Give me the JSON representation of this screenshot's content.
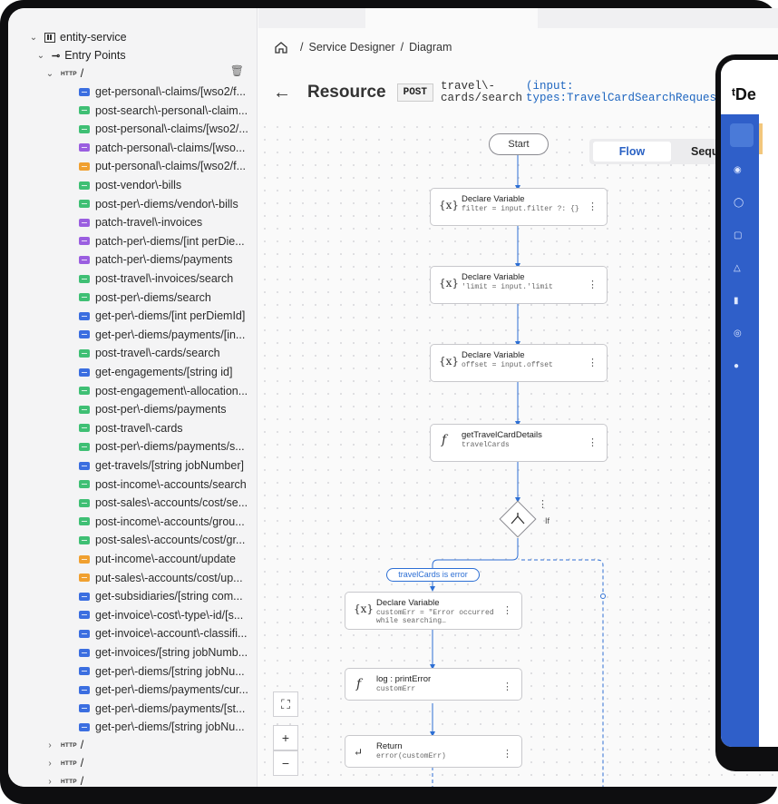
{
  "sidebar": {
    "service_name": "entity-service",
    "entry_points_label": "Entry Points",
    "http_label": "HTTP",
    "path_label": "/",
    "resources": [
      {
        "method": "get",
        "label": "get-personal\\-claims/[wso2/f..."
      },
      {
        "method": "post",
        "label": "post-search\\-personal\\-claim..."
      },
      {
        "method": "post",
        "label": "post-personal\\-claims/[wso2/..."
      },
      {
        "method": "patch",
        "label": "patch-personal\\-claims/[wso..."
      },
      {
        "method": "put",
        "label": "put-personal\\-claims/[wso2/f..."
      },
      {
        "method": "post",
        "label": "post-vendor\\-bills"
      },
      {
        "method": "post",
        "label": "post-per\\-diems/vendor\\-bills"
      },
      {
        "method": "patch",
        "label": "patch-travel\\-invoices"
      },
      {
        "method": "patch",
        "label": "patch-per\\-diems/[int perDie..."
      },
      {
        "method": "patch",
        "label": "patch-per\\-diems/payments"
      },
      {
        "method": "post",
        "label": "post-travel\\-invoices/search"
      },
      {
        "method": "post",
        "label": "post-per\\-diems/search"
      },
      {
        "method": "get",
        "label": "get-per\\-diems/[int perDiemId]"
      },
      {
        "method": "get",
        "label": "get-per\\-diems/payments/[in..."
      },
      {
        "method": "post",
        "label": "post-travel\\-cards/search"
      },
      {
        "method": "get",
        "label": "get-engagements/[string id]"
      },
      {
        "method": "post",
        "label": "post-engagement\\-allocation..."
      },
      {
        "method": "post",
        "label": "post-per\\-diems/payments"
      },
      {
        "method": "post",
        "label": "post-travel\\-cards"
      },
      {
        "method": "post",
        "label": "post-per\\-diems/payments/s..."
      },
      {
        "method": "get",
        "label": "get-travels/[string jobNumber]"
      },
      {
        "method": "post",
        "label": "post-income\\-accounts/search"
      },
      {
        "method": "post",
        "label": "post-sales\\-accounts/cost/se..."
      },
      {
        "method": "post",
        "label": "post-income\\-accounts/grou..."
      },
      {
        "method": "post",
        "label": "post-sales\\-accounts/cost/gr..."
      },
      {
        "method": "put",
        "label": "put-income\\-account/update"
      },
      {
        "method": "put",
        "label": "put-sales\\-accounts/cost/up..."
      },
      {
        "method": "get",
        "label": "get-subsidiaries/[string com..."
      },
      {
        "method": "get",
        "label": "get-invoice\\-cost\\-type\\-id/[s..."
      },
      {
        "method": "get",
        "label": "get-invoice\\-account\\-classifi..."
      },
      {
        "method": "get",
        "label": "get-invoices/[string jobNumb..."
      },
      {
        "method": "get",
        "label": "get-per\\-diems/[string jobNu..."
      },
      {
        "method": "get",
        "label": "get-per\\-diems/payments/cur..."
      },
      {
        "method": "get",
        "label": "get-per\\-diems/payments/[st..."
      },
      {
        "method": "get",
        "label": "get-per\\-diems/[string jobNu..."
      }
    ],
    "collapsed_groups": [
      "/",
      "/",
      "/"
    ]
  },
  "breadcrumb": {
    "service_designer": "Service Designer",
    "diagram": "Diagram",
    "separator": "/"
  },
  "resource": {
    "title": "Resource",
    "method": "POST",
    "path_line1": "travel\\-",
    "path_line2": "cards/search",
    "param_line1": "(input:",
    "param_line2": "types:TravelCardSearchRequest"
  },
  "view_toggle": {
    "flow": "Flow",
    "sequence": "Sequ"
  },
  "flow": {
    "start": "Start",
    "nodes": [
      {
        "icon": "{x}",
        "title": "Declare Variable",
        "sub": "filter = input.filter ?: {}"
      },
      {
        "icon": "{x}",
        "title": "Declare Variable",
        "sub": "'limit = input.'limit"
      },
      {
        "icon": "{x}",
        "title": "Declare Variable",
        "sub": "offset = input.offset"
      },
      {
        "icon": "f",
        "title": "getTravelCardDetails",
        "sub": "travelCards"
      }
    ],
    "if_label": "If",
    "condition": "travelCards is error",
    "branch_nodes": [
      {
        "icon": "{x}",
        "title": "Declare Variable",
        "sub": "customErr = \"Error occurred while searching…"
      },
      {
        "icon": "f",
        "title": "log : printError",
        "sub": "customErr"
      },
      {
        "icon": "↵",
        "title": "Return",
        "sub": "error(customErr)"
      }
    ],
    "more_glyph": "⋮"
  },
  "zoom": {
    "fit": "⛶",
    "plus": "+",
    "minus": "−"
  },
  "overlay_app": {
    "logo": "ᵗDe"
  },
  "colors": {
    "accent": "#2a62c4",
    "get": "#3b6ee0",
    "post": "#3fbf74",
    "put": "#f0a030",
    "patch": "#9a5ee0",
    "rail": "#2f5fc9"
  }
}
